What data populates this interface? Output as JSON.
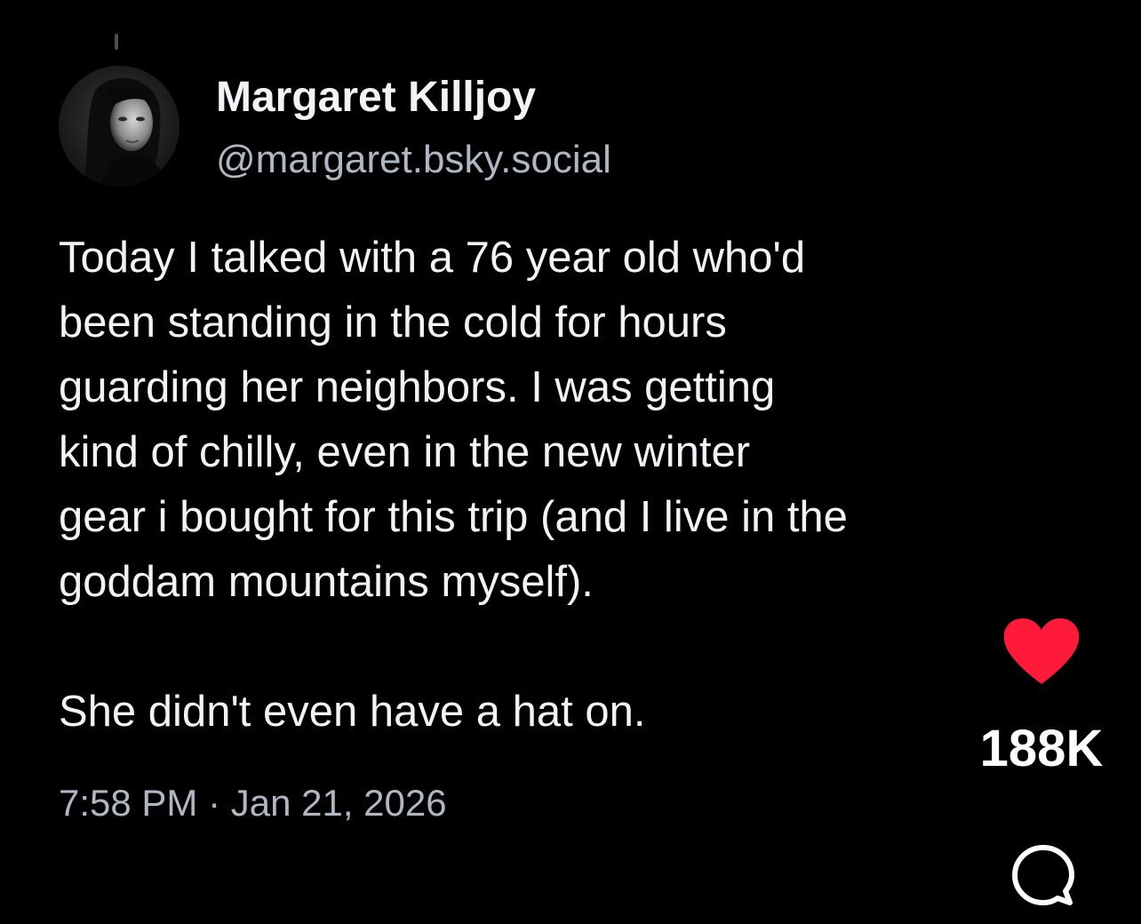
{
  "post": {
    "author": {
      "display_name": "Margaret Killjoy",
      "handle": "@margaret.bsky.social",
      "avatar_icon": "profile-photo"
    },
    "body_paragraphs": [
      "Today I talked with a 76 year old who'd\nbeen standing in the cold for hours\nguarding her neighbors. I was getting\nkind of chilly, even in the new winter\ngear i bought for this trip (and I live in the\ngoddam mountains myself).",
      "She didn't even have a hat on."
    ],
    "timestamp": "7:58 PM · Jan 21, 2026"
  },
  "actions": {
    "like": {
      "icon": "heart-icon",
      "count": "188K",
      "liked": true,
      "color": "#ff1a3a"
    },
    "comment": {
      "icon": "speech-bubble-icon",
      "color": "#ffffff"
    }
  },
  "theme": {
    "background": "#000000",
    "text_primary": "#f1f3f5",
    "text_secondary": "#aeb7c2"
  }
}
